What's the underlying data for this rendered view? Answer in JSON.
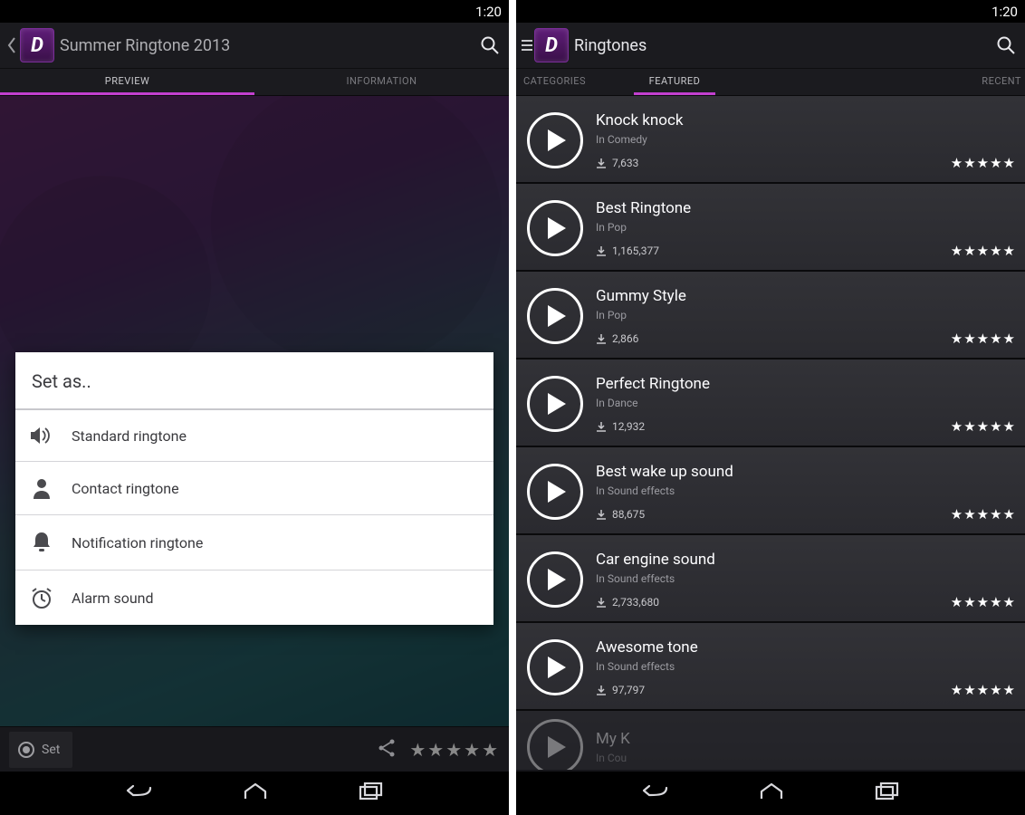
{
  "status": {
    "time": "1:20"
  },
  "left": {
    "title": "Summer Ringtone 2013",
    "tabs": [
      "PREVIEW",
      "INFORMATION"
    ],
    "active_tab": 0,
    "dialog": {
      "title": "Set as..",
      "items": [
        {
          "label": "Standard ringtone",
          "icon": "volume-icon"
        },
        {
          "label": "Contact ringtone",
          "icon": "person-icon"
        },
        {
          "label": "Notification ringtone",
          "icon": "bell-icon"
        },
        {
          "label": "Alarm sound",
          "icon": "alarm-icon"
        }
      ]
    },
    "set_label": "Set"
  },
  "right": {
    "title": "Ringtones",
    "tabs": [
      "CATEGORIES",
      "FEATURED",
      "RECENT"
    ],
    "active_tab": 1,
    "items": [
      {
        "name": "Knock knock",
        "category": "In Comedy",
        "downloads": "7,633",
        "stars": 5
      },
      {
        "name": "Best Ringtone",
        "category": "In Pop",
        "downloads": "1,165,377",
        "stars": 5
      },
      {
        "name": "Gummy Style",
        "category": "In Pop",
        "downloads": "2,866",
        "stars": 5
      },
      {
        "name": "Perfect Ringtone",
        "category": "In Dance",
        "downloads": "12,932",
        "stars": 5
      },
      {
        "name": "Best wake up sound",
        "category": "In Sound effects",
        "downloads": "88,675",
        "stars": 5
      },
      {
        "name": "Car engine sound",
        "category": "In Sound effects",
        "downloads": "2,733,680",
        "stars": 5
      },
      {
        "name": "Awesome tone",
        "category": "In Sound effects",
        "downloads": "97,797",
        "stars": 5
      },
      {
        "name": "My K",
        "category": "In Cou",
        "downloads": "",
        "stars": 0
      }
    ]
  }
}
